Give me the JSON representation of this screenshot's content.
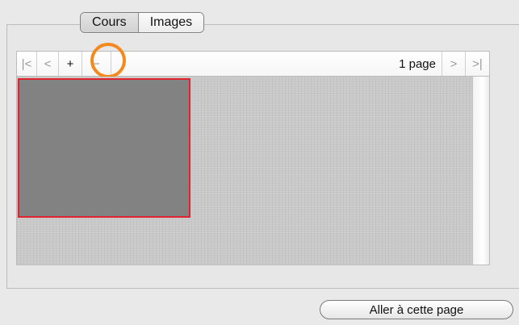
{
  "tabs": {
    "items": [
      {
        "label": "Cours"
      },
      {
        "label": "Images"
      }
    ],
    "selected": "Cours"
  },
  "toolbar": {
    "first_label": "|<",
    "prev_label": "<",
    "zoom_in_label": "+",
    "zoom_out_label": "−",
    "page_count": "1 page",
    "next_label": ">",
    "last_label": ">|"
  },
  "colors": {
    "highlight": "#f48a1e",
    "selected_thumbnail_border": "#e0232f",
    "thumbnail_fill": "#828282"
  },
  "footer": {
    "goto_label": "Aller à cette page"
  }
}
